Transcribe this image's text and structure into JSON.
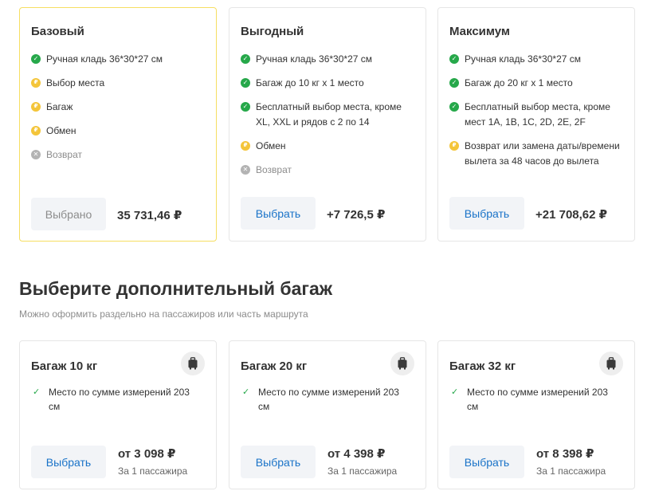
{
  "tariffs": [
    {
      "name": "Базовый",
      "selected": true,
      "features": [
        {
          "status": "included",
          "text": "Ручная кладь 36*30*27 см"
        },
        {
          "status": "paid",
          "text": "Выбор места"
        },
        {
          "status": "paid",
          "text": "Багаж"
        },
        {
          "status": "paid",
          "text": "Обмен"
        },
        {
          "status": "unavailable",
          "text": "Возврат"
        }
      ],
      "button_label": "Выбрано",
      "price": "35 731,46 ₽"
    },
    {
      "name": "Выгодный",
      "selected": false,
      "features": [
        {
          "status": "included",
          "text": "Ручная кладь 36*30*27 см"
        },
        {
          "status": "included",
          "text": "Багаж до 10 кг х 1 место"
        },
        {
          "status": "included",
          "text": "Бесплатный выбор места, кроме XL, XXL и рядов с 2 по 14"
        },
        {
          "status": "paid",
          "text": "Обмен"
        },
        {
          "status": "unavailable",
          "text": "Возврат"
        }
      ],
      "button_label": "Выбрать",
      "price": "+7 726,5 ₽"
    },
    {
      "name": "Максимум",
      "selected": false,
      "features": [
        {
          "status": "included",
          "text": "Ручная кладь 36*30*27 см"
        },
        {
          "status": "included",
          "text": "Багаж до 20 кг х 1 место"
        },
        {
          "status": "included",
          "text": "Бесплатный выбор места, кроме мест 1A, 1B, 1C, 2D, 2E, 2F"
        },
        {
          "status": "paid",
          "text": "Возврат или замена даты/времени вылета за 48 часов до вылета"
        }
      ],
      "button_label": "Выбрать",
      "price": "+21 708,62 ₽"
    }
  ],
  "luggage_section": {
    "title": "Выберите дополнительный багаж",
    "subtitle": "Можно оформить раздельно на пассажиров или часть маршрута"
  },
  "luggage_options": [
    {
      "name": "Багаж 10 кг",
      "icon": "suitcase-icon",
      "feature": "Место по сумме измерений 203 см",
      "button_label": "Выбрать",
      "price": "от 3 098 ₽",
      "price_note": "За 1 пассажира"
    },
    {
      "name": "Багаж 20 кг",
      "icon": "suitcase-icon",
      "feature": "Место по сумме измерений 203 см",
      "button_label": "Выбрать",
      "price": "от 4 398 ₽",
      "price_note": "За 1 пассажира"
    },
    {
      "name": "Багаж 32 кг",
      "icon": "suitcase-icon",
      "feature": "Место по сумме измерений 203 см",
      "button_label": "Выбрать",
      "price": "от 8 398 ₽",
      "price_note": "За 1 пассажира"
    }
  ],
  "colors": {
    "selected_border": "#f6de62",
    "included": "#26a84a",
    "paid": "#f4c53a",
    "unavailable": "#b3b3b3",
    "link": "#1a73c8"
  }
}
